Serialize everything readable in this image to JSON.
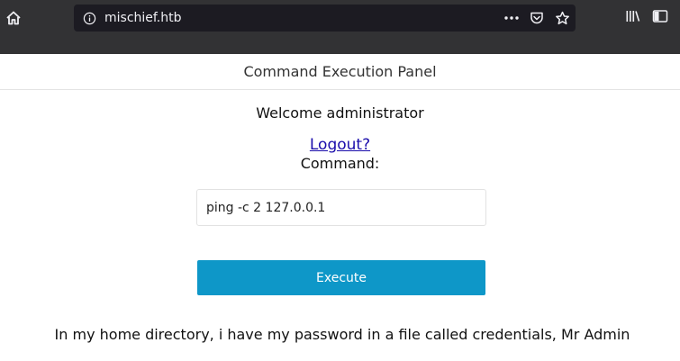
{
  "browser": {
    "url": "mischief.htb",
    "icons": {
      "home": "home-icon",
      "info": "info-icon",
      "more": "more-actions-icon",
      "pocket": "pocket-icon",
      "bookmark": "bookmark-star-icon",
      "library": "library-icon",
      "sidebar": "sidebar-icon"
    },
    "colors": {
      "toolbar": "#323234",
      "urlbar": "#1c1b22"
    }
  },
  "page": {
    "header_title": "Command Execution Panel",
    "welcome": "Welcome administrator",
    "logout_label": "Logout?",
    "command_label": "Command:",
    "command_value": "ping -c 2 127.0.0.1",
    "execute_label": "Execute",
    "note": "In my home directory, i have my password in a file called credentials, Mr Admin",
    "colors": {
      "execute_button": "#0e97c8",
      "link": "#1a0dab"
    }
  }
}
